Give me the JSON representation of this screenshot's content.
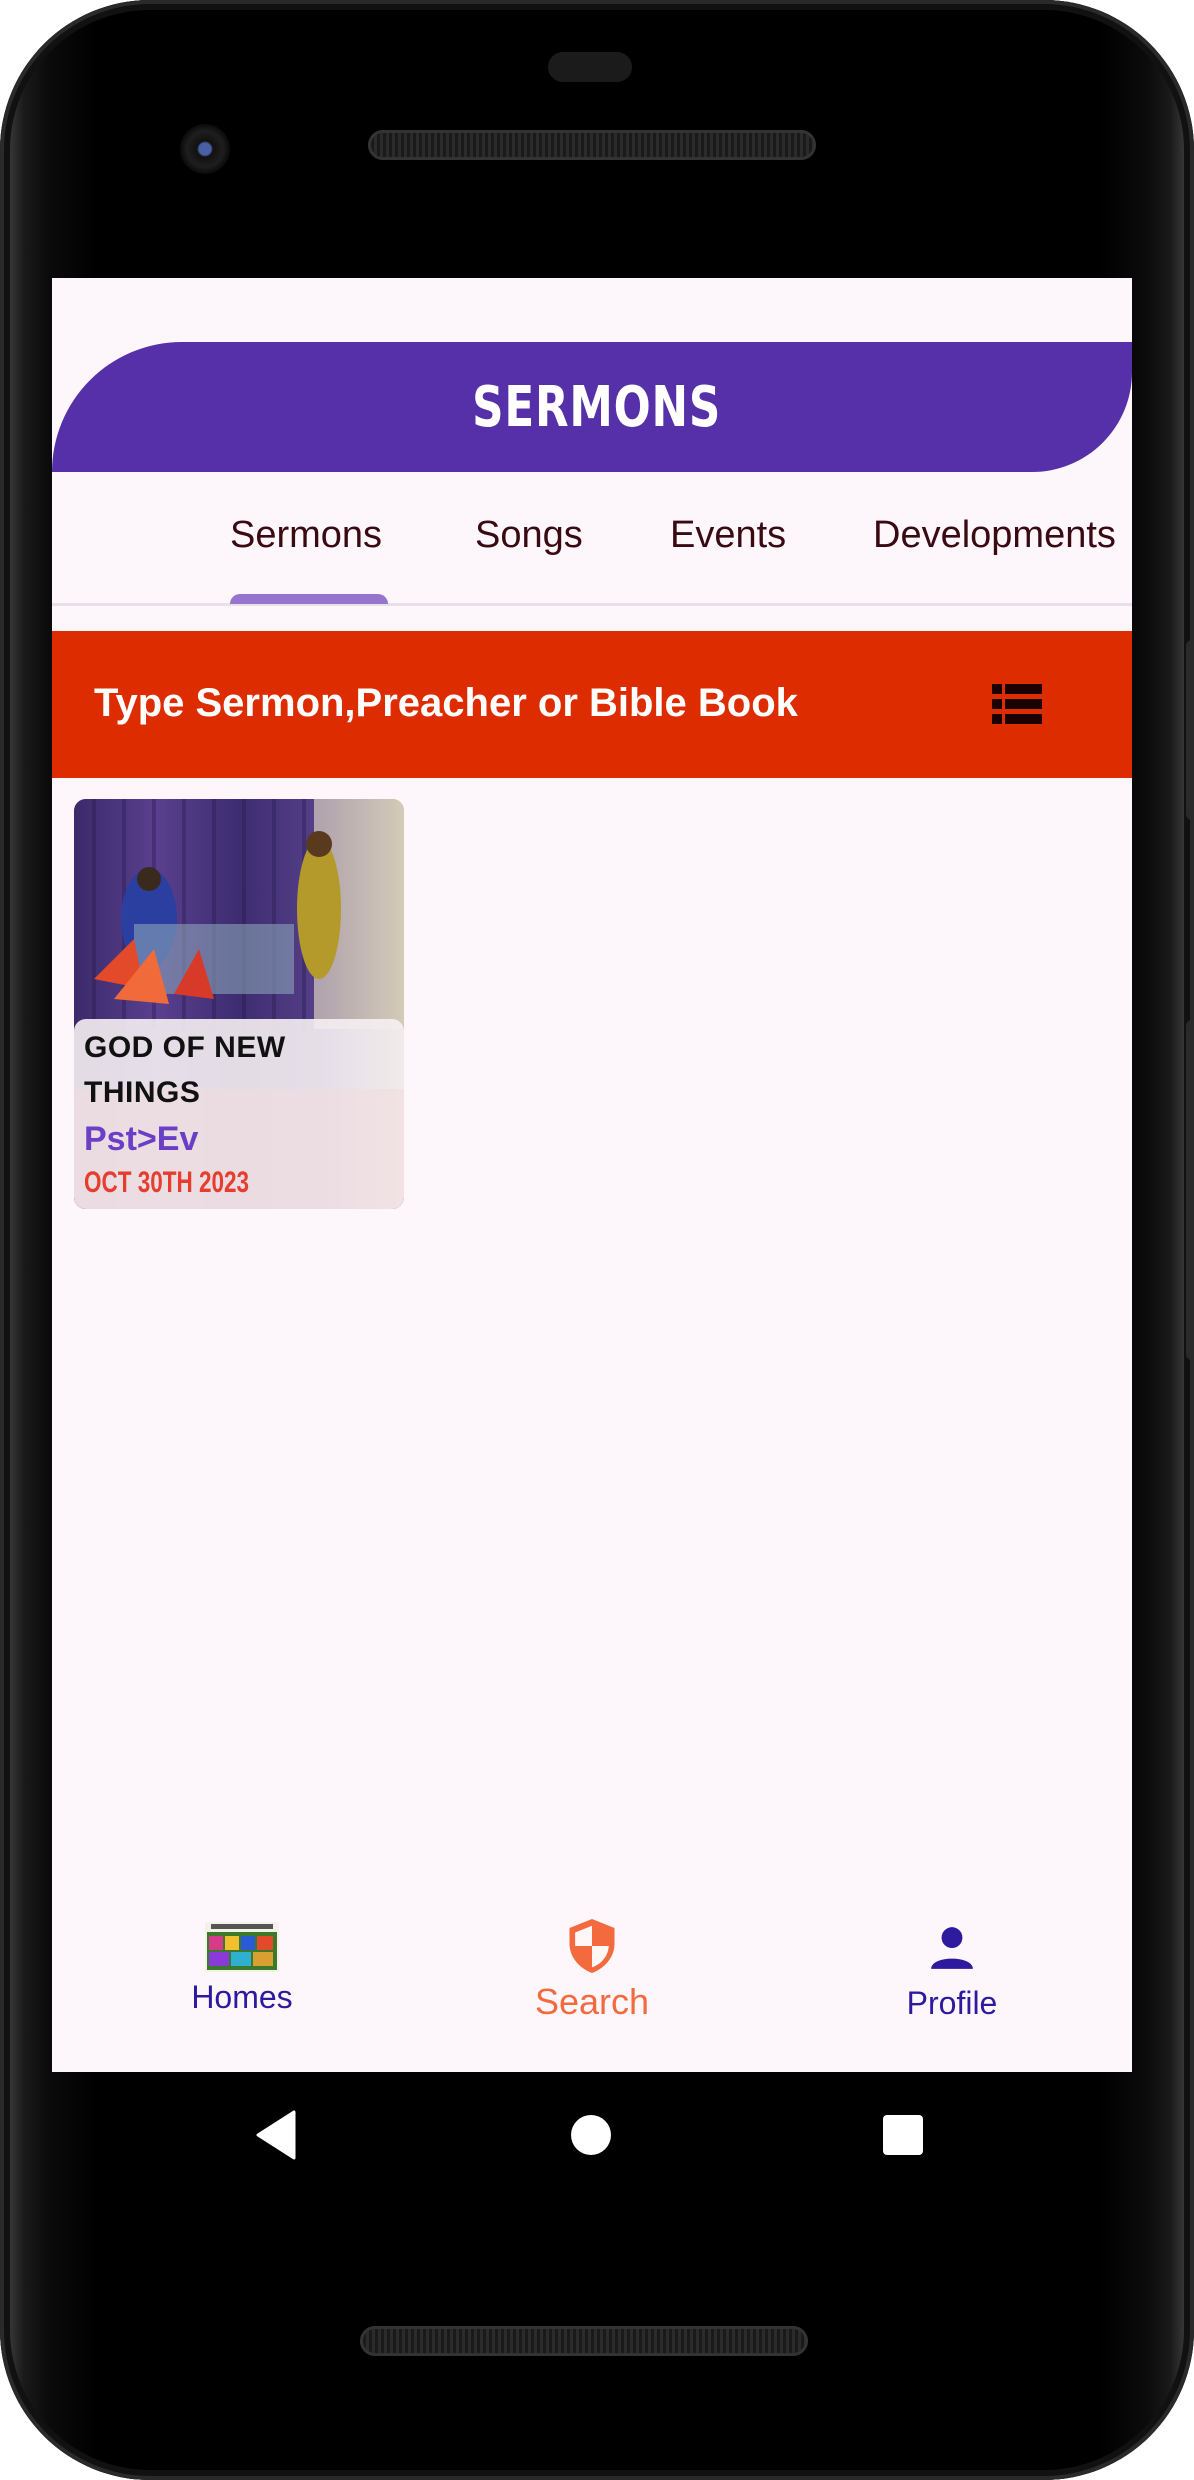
{
  "header": {
    "title": "SERMONS"
  },
  "tabs": [
    {
      "label": "Sermons",
      "selected": true
    },
    {
      "label": "Songs",
      "selected": false
    },
    {
      "label": "Events",
      "selected": false
    },
    {
      "label": "Developments",
      "selected": false
    }
  ],
  "search": {
    "placeholder": "Type Sermon,Preacher or Bible Book",
    "view_toggle_icon": "list-icon"
  },
  "sermons": [
    {
      "title": "GOD OF NEW THINGS",
      "preacher": "Pst>Ev",
      "date": "OCT 30TH 2023"
    }
  ],
  "bottom_nav": [
    {
      "label": "Homes",
      "icon": "homes-thumbnail-icon",
      "color": "#2e1a9e"
    },
    {
      "label": "Search",
      "icon": "shield-icon",
      "color": "#f26a3e"
    },
    {
      "label": "Profile",
      "icon": "person-icon",
      "color": "#2e1a9e"
    }
  ],
  "colors": {
    "header": "#5530a8",
    "search_bar": "#dd2c00",
    "tab_indicator": "#9575cd",
    "tab_text": "#3a0a12",
    "date": "#e53e2e",
    "preacher": "#6a3fc6"
  }
}
